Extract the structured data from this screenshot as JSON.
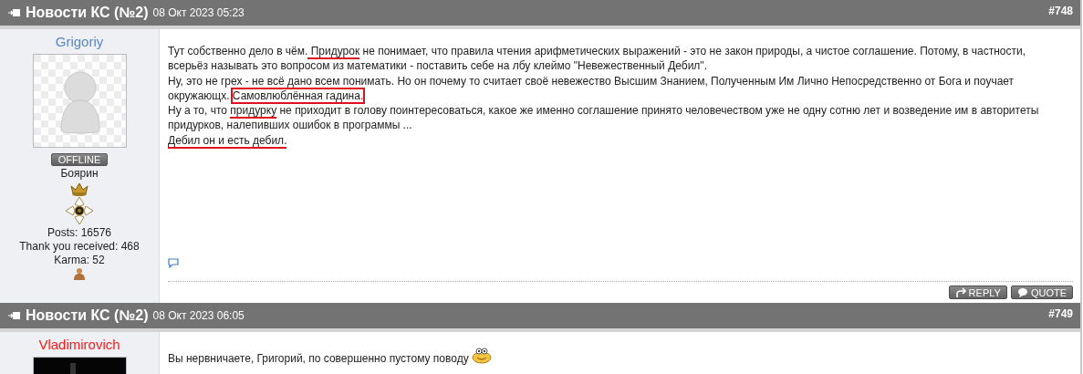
{
  "posts": [
    {
      "title": "Новости КС (№2)",
      "date": "08 Окт 2023 05:23",
      "number": "#748",
      "author": {
        "name": "Grigoriy",
        "color": "#5b87c5",
        "avatar": {
          "kind": "silhouette"
        },
        "status": "OFFLINE",
        "rank": "Боярин",
        "medal": true,
        "stats": [
          "Posts: 16576",
          "Thank you received: 468",
          "Karma: 52"
        ],
        "karma_icon": true
      },
      "paragraphs": [
        [
          {
            "kind": "text",
            "text": "Тут собственно дело в чём.",
            "underlined": false,
            "boxed": false
          },
          {
            "kind": "text",
            "text": " Придурок",
            "underlined": true,
            "boxed": false
          },
          {
            "kind": "text",
            "text": " не понимает, что правила чтения арифметических выражений - это не закон природы, а чистое соглашение. Потому, в частности, всерьёз называть это вопросом из математики - поставить себе на лбу клеймо \"Невежественный Дебил\".",
            "underlined": false,
            "boxed": false
          }
        ],
        [
          {
            "kind": "text",
            "text": "Ну, это не грех - не всё дано всем понимать. Но он почему то считает своё невежество Высшим Знанием, Полученным Им Лично Непосредственно от Бога и поучает окружающх. ",
            "underlined": false,
            "boxed": false
          },
          {
            "kind": "text",
            "text": "Самовлюблённая гадина.",
            "underlined": false,
            "boxed": true
          }
        ],
        [
          {
            "kind": "text",
            "text": "Ну а то, что ",
            "underlined": false,
            "boxed": false
          },
          {
            "kind": "text",
            "text": "придурку",
            "underlined": true,
            "boxed": false
          },
          {
            "kind": "text",
            "text": " не приходит в голову поинтересоваться, какое же именно соглашение принято человечеством уже не одну сотню лет и возведение им в авторитеты придурков, налепивших ошибок в программы ...",
            "underlined": false,
            "boxed": false
          }
        ],
        [
          {
            "kind": "text",
            "text": "Дебил он и есть дебил.",
            "underlined": true,
            "boxed": false
          }
        ]
      ],
      "comment_icon": true,
      "buttons": [
        {
          "kind": "reply",
          "label": "REPLY"
        },
        {
          "kind": "quote",
          "label": "QUOTE"
        }
      ]
    },
    {
      "title": "Новости КС (№2)",
      "date": "08 Окт 2023 06:05",
      "number": "#749",
      "author": {
        "name": "Vladimirovich",
        "color": "#ff1a1a"
      },
      "paragraphs": [
        [
          {
            "kind": "text",
            "text": "Вы нервничаете, Григорий, по совершенно пустому поводу ",
            "underlined": false,
            "boxed": false
          },
          {
            "kind": "smiley"
          }
        ]
      ]
    }
  ]
}
